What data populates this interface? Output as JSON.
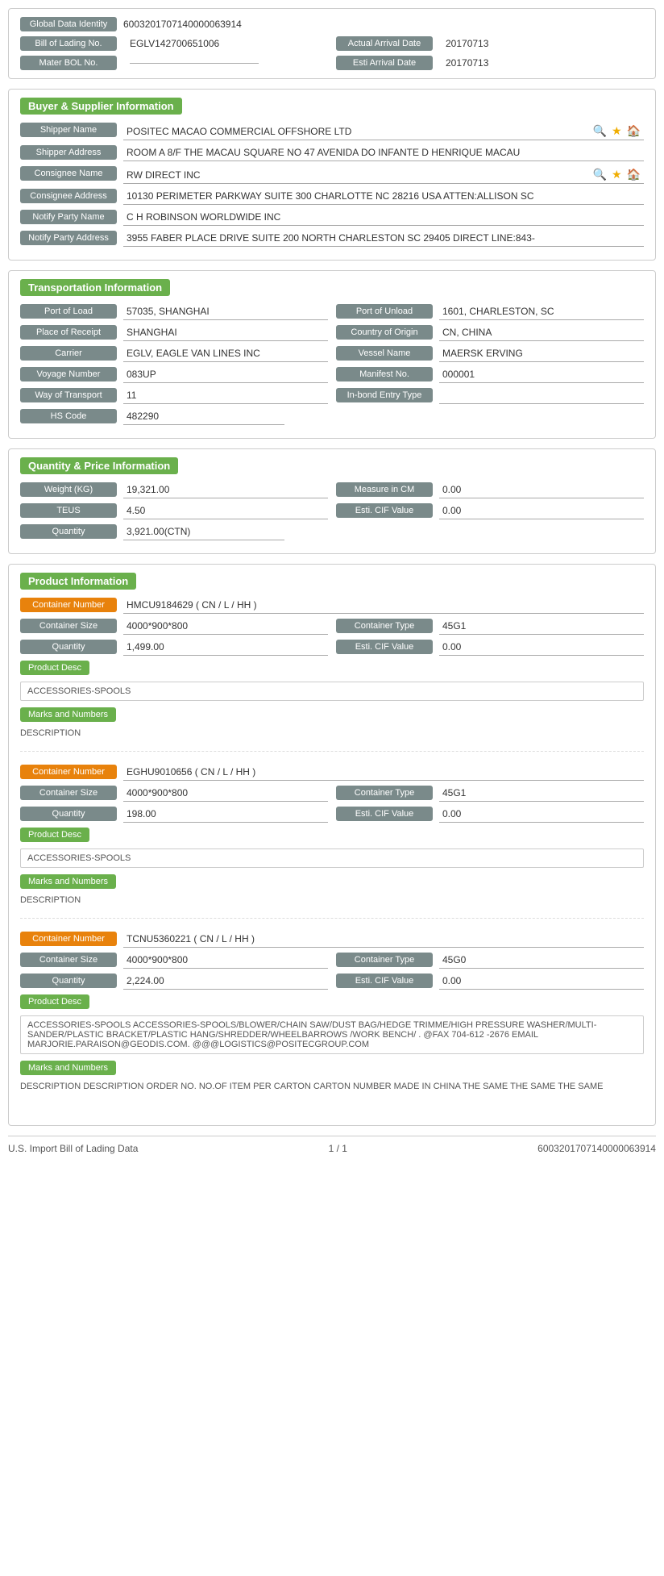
{
  "global": {
    "identity_label": "Global Data Identity",
    "identity_value": "6003201707140000063914",
    "bill_label": "Bill of Lading No.",
    "bill_value": "EGLV142700651006",
    "arrival_date_label": "Actual Arrival Date",
    "arrival_date_value": "20170713",
    "mater_bol_label": "Mater BOL No.",
    "mater_bol_value": "",
    "esti_arrival_label": "Esti Arrival Date",
    "esti_arrival_value": "20170713"
  },
  "buyer_supplier": {
    "section_title": "Buyer & Supplier Information",
    "shipper_name_label": "Shipper Name",
    "shipper_name_value": "POSITEC MACAO COMMERCIAL OFFSHORE LTD",
    "shipper_address_label": "Shipper Address",
    "shipper_address_value": "ROOM A 8/F THE MACAU SQUARE NO 47 AVENIDA DO INFANTE D HENRIQUE MACAU",
    "consignee_name_label": "Consignee Name",
    "consignee_name_value": "RW DIRECT INC",
    "consignee_address_label": "Consignee Address",
    "consignee_address_value": "10130 PERIMETER PARKWAY SUITE 300 CHARLOTTE NC 28216 USA ATTEN:ALLISON SC",
    "notify_party_name_label": "Notify Party Name",
    "notify_party_name_value": "C H ROBINSON WORLDWIDE INC",
    "notify_party_address_label": "Notify Party Address",
    "notify_party_address_value": "3955 FABER PLACE DRIVE SUITE 200 NORTH CHARLESTON SC 29405 DIRECT LINE:843-"
  },
  "transportation": {
    "section_title": "Transportation Information",
    "port_of_load_label": "Port of Load",
    "port_of_load_value": "57035, SHANGHAI",
    "port_of_unload_label": "Port of Unload",
    "port_of_unload_value": "1601, CHARLESTON, SC",
    "place_of_receipt_label": "Place of Receipt",
    "place_of_receipt_value": "SHANGHAI",
    "country_of_origin_label": "Country of Origin",
    "country_of_origin_value": "CN, CHINA",
    "carrier_label": "Carrier",
    "carrier_value": "EGLV, EAGLE VAN LINES INC",
    "vessel_name_label": "Vessel Name",
    "vessel_name_value": "MAERSK ERVING",
    "voyage_number_label": "Voyage Number",
    "voyage_number_value": "083UP",
    "manifest_no_label": "Manifest No.",
    "manifest_no_value": "000001",
    "way_of_transport_label": "Way of Transport",
    "way_of_transport_value": "11",
    "in_bond_entry_label": "In-bond Entry Type",
    "in_bond_entry_value": "",
    "hs_code_label": "HS Code",
    "hs_code_value": "482290"
  },
  "quantity_price": {
    "section_title": "Quantity & Price Information",
    "weight_label": "Weight (KG)",
    "weight_value": "19,321.00",
    "measure_cm_label": "Measure in CM",
    "measure_cm_value": "0.00",
    "teus_label": "TEUS",
    "teus_value": "4.50",
    "esti_cif_label": "Esti. CIF Value",
    "esti_cif_value": "0.00",
    "quantity_label": "Quantity",
    "quantity_value": "3,921.00(CTN)"
  },
  "product_info": {
    "section_title": "Product Information",
    "containers": [
      {
        "container_number_label": "Container Number",
        "container_number_value": "HMCU9184629 ( CN / L / HH )",
        "container_size_label": "Container Size",
        "container_size_value": "4000*900*800",
        "container_type_label": "Container Type",
        "container_type_value": "45G1",
        "quantity_label": "Quantity",
        "quantity_value": "1,499.00",
        "esti_cif_label": "Esti. CIF Value",
        "esti_cif_value": "0.00",
        "product_desc_label": "Product Desc",
        "product_desc_value": "ACCESSORIES-SPOOLS",
        "marks_label": "Marks and Numbers",
        "marks_value": "DESCRIPTION"
      },
      {
        "container_number_label": "Container Number",
        "container_number_value": "EGHU9010656 ( CN / L / HH )",
        "container_size_label": "Container Size",
        "container_size_value": "4000*900*800",
        "container_type_label": "Container Type",
        "container_type_value": "45G1",
        "quantity_label": "Quantity",
        "quantity_value": "198.00",
        "esti_cif_label": "Esti. CIF Value",
        "esti_cif_value": "0.00",
        "product_desc_label": "Product Desc",
        "product_desc_value": "ACCESSORIES-SPOOLS",
        "marks_label": "Marks and Numbers",
        "marks_value": "DESCRIPTION"
      },
      {
        "container_number_label": "Container Number",
        "container_number_value": "TCNU5360221 ( CN / L / HH )",
        "container_size_label": "Container Size",
        "container_size_value": "4000*900*800",
        "container_type_label": "Container Type",
        "container_type_value": "45G0",
        "quantity_label": "Quantity",
        "quantity_value": "2,224.00",
        "esti_cif_label": "Esti. CIF Value",
        "esti_cif_value": "0.00",
        "product_desc_label": "Product Desc",
        "product_desc_value": "ACCESSORIES-SPOOLS ACCESSORIES-SPOOLS/BLOWER/CHAIN SAW/DUST BAG/HEDGE TRIMME/HIGH PRESSURE WASHER/MULTI-SANDER/PLASTIC BRACKET/PLASTIC HANG/SHREDDER/WHEELBARROWS /WORK BENCH/ . @FAX 704-612 -2676 EMAIL MARJORIE.PARAISON@GEODIS.COM. @@@LOGISTICS@POSITECGROUP.COM",
        "marks_label": "Marks and Numbers",
        "marks_value": "DESCRIPTION DESCRIPTION ORDER NO. NO.OF ITEM PER CARTON CARTON NUMBER MADE IN CHINA THE SAME THE SAME THE SAME"
      }
    ]
  },
  "footer": {
    "left": "U.S. Import Bill of Lading Data",
    "center": "1 / 1",
    "right": "6003201707140000063914"
  }
}
